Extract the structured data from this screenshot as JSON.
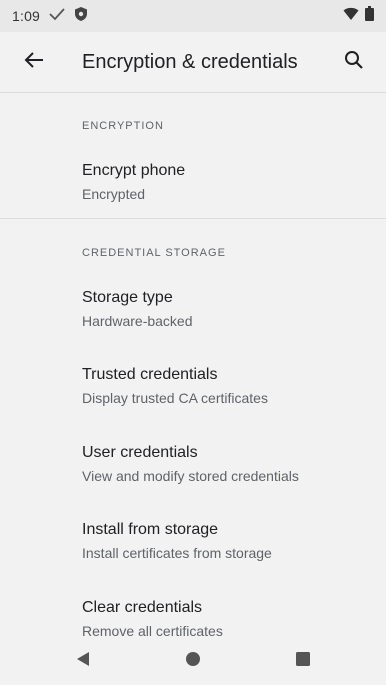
{
  "status": {
    "time": "1:09",
    "icons": [
      "check-icon",
      "shield-icon",
      "wifi-icon",
      "battery-icon"
    ]
  },
  "toolbar": {
    "title": "Encryption & credentials",
    "back_icon": "arrow-back-icon",
    "search_icon": "search-icon"
  },
  "sections": {
    "encryption": {
      "header": "ENCRYPTION",
      "items": [
        {
          "title": "Encrypt phone",
          "summary": "Encrypted"
        }
      ]
    },
    "credential_storage": {
      "header": "CREDENTIAL STORAGE",
      "items": [
        {
          "title": "Storage type",
          "summary": "Hardware-backed"
        },
        {
          "title": "Trusted credentials",
          "summary": "Display trusted CA certificates"
        },
        {
          "title": "User credentials",
          "summary": "View and modify stored credentials"
        },
        {
          "title": "Install from storage",
          "summary": "Install certificates from storage"
        },
        {
          "title": "Clear credentials",
          "summary": "Remove all certificates"
        }
      ]
    }
  },
  "navbar": {
    "icons": [
      "back-triangle-icon",
      "home-circle-icon",
      "recents-square-icon"
    ]
  },
  "colors": {
    "background": "#f2f2f2",
    "statusbar": "#e8e8e8",
    "primary_text": "#202124",
    "secondary_text": "#5f6368",
    "divider": "#dcdcdc"
  }
}
